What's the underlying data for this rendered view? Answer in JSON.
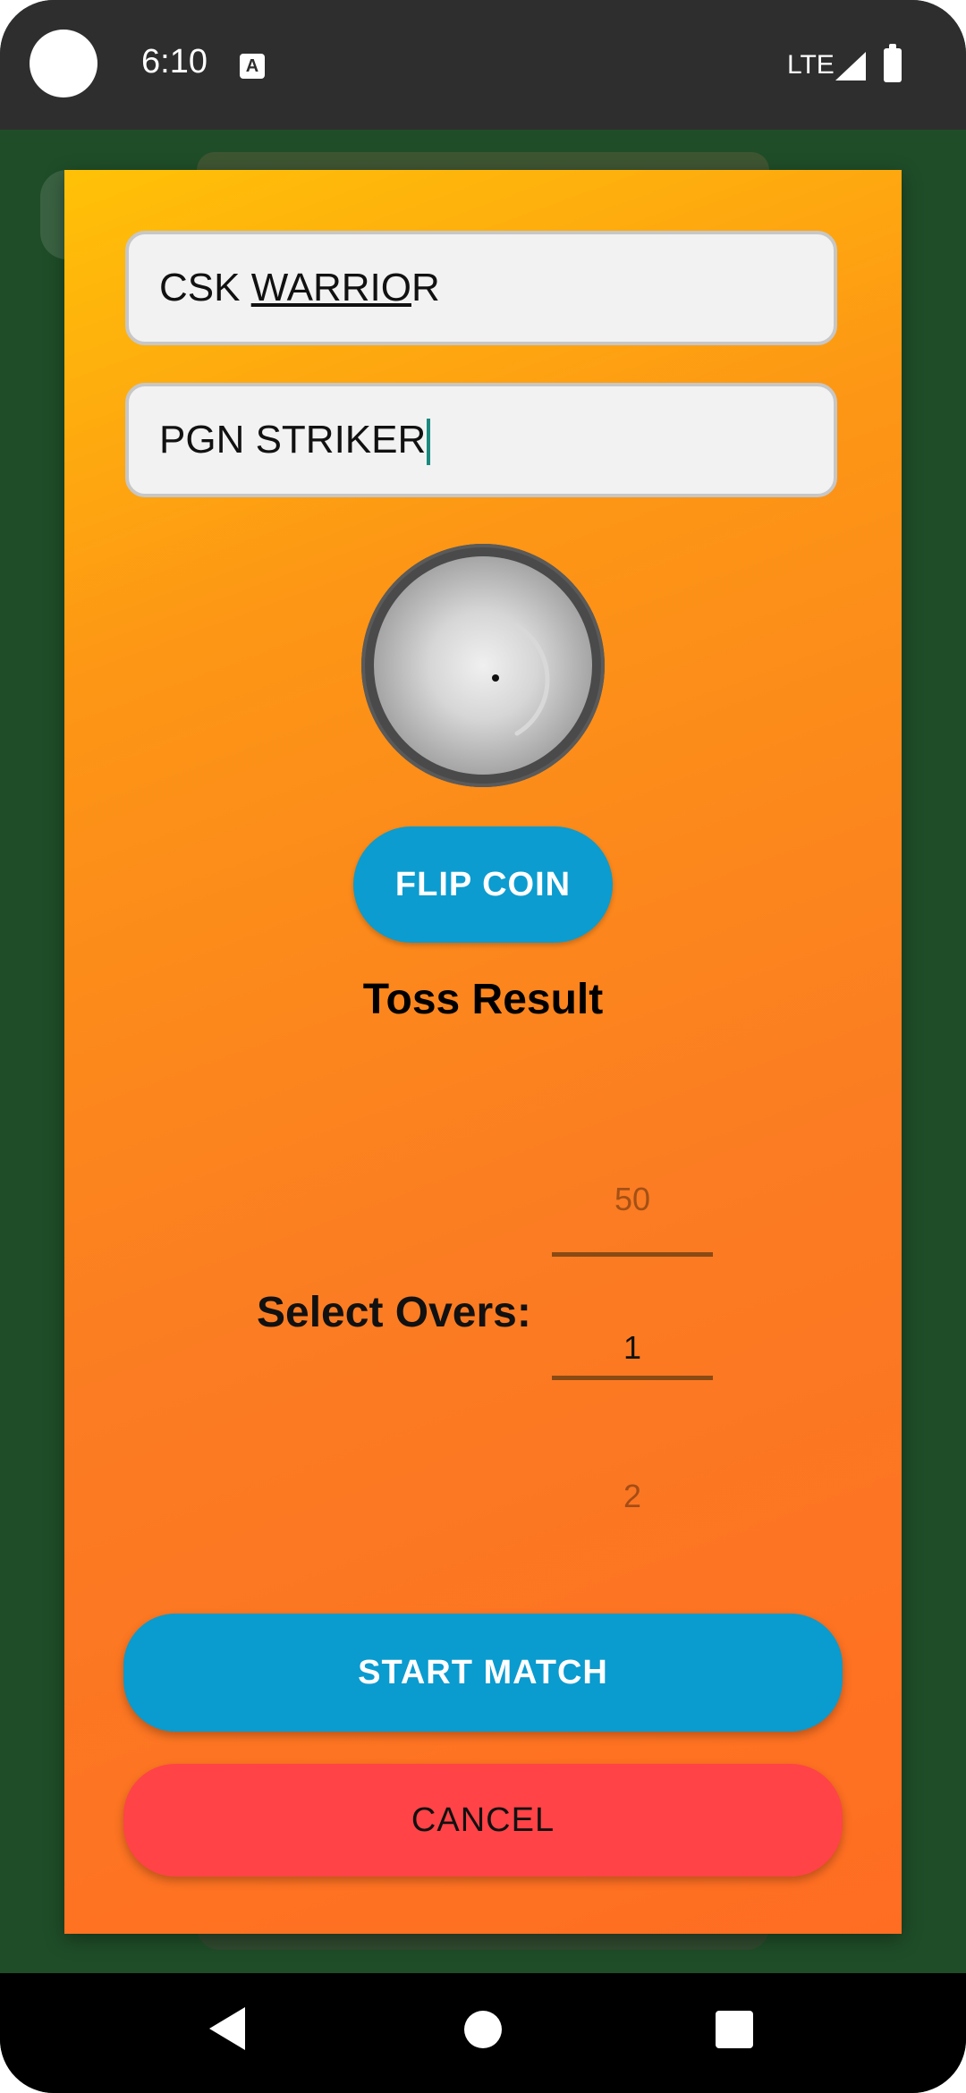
{
  "status_bar": {
    "time": "6:10",
    "network": "LTE",
    "icons": [
      "camera-cutout",
      "notification-icon",
      "signal-icon",
      "battery-icon"
    ]
  },
  "dialog": {
    "team1_name": "CSK WARRIOR",
    "team2_name": "PGN STRIKER",
    "coin_icon": "coin-icon",
    "flip_button_label": "FLIP COIN",
    "toss_result_text": "Toss Result",
    "overs_label": "Select Overs:",
    "overs_picker": {
      "previous": "50",
      "selected": "1",
      "next": "2"
    },
    "start_button_label": "START MATCH",
    "cancel_button_label": "CANCEL",
    "colors": {
      "gradient_start": "#ffc107",
      "gradient_end": "#ff6d22",
      "primary_button": "#0a9bcf",
      "cancel_button": "#ff4347"
    }
  },
  "nav_bar": {
    "buttons": [
      "back-icon",
      "home-icon",
      "recents-icon"
    ]
  }
}
